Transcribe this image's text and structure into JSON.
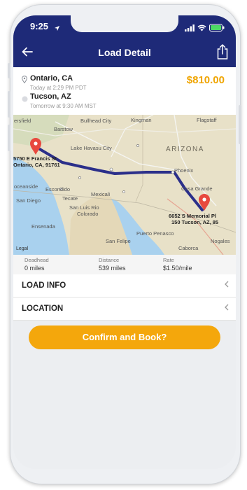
{
  "status_bar": {
    "time": "9:25"
  },
  "header": {
    "title": "Load Detail"
  },
  "route": {
    "origin": {
      "city": "Ontario, CA",
      "time": "Today at 2:29 PM PDT"
    },
    "destination": {
      "city": "Tucson, AZ",
      "time": "Tomorrow at 9:30 AM MST"
    },
    "price": "$810.00"
  },
  "map": {
    "labels": {
      "ersfield": "ersfield",
      "barstow": "Barstow",
      "bullhead": "Bullhead City",
      "kingman": "Kingman",
      "flagstaff": "Flagstaff",
      "lake_havasu": "Lake Havasu City",
      "arizona": "ARIZONA",
      "phoenix": "Phoenix",
      "casa_grande": "Casa Grande",
      "oceanside": "oceanside",
      "escondido": "Escondido",
      "san_diego": "San Diego",
      "tecate": "Tecate",
      "mexicali": "Mexicali",
      "san_luis": "San Luis Rio",
      "colorado": "Colorado",
      "ensenada": "Ensenada",
      "san_felipe": "San Felipe",
      "puerto_penasco": "Puerto Penasco",
      "caborca": "Caborca",
      "nogales": "Nogales",
      "legal": "Legal"
    },
    "origin_address_1": "5750 E Francis St",
    "origin_address_2": "Ontario, CA, 91761",
    "dest_address_1": "6652 S Memorial Pl",
    "dest_address_2": "150 Tucson, AZ, 85"
  },
  "stats": [
    {
      "label": "Deadhead",
      "value": "0 miles"
    },
    {
      "label": "Distance",
      "value": "539 miles"
    },
    {
      "label": "Rate",
      "value": "$1.50/mile"
    }
  ],
  "sections": [
    {
      "label": "LOAD INFO"
    },
    {
      "label": "LOCATION"
    }
  ],
  "actions": {
    "confirm_label": "Confirm and Book?"
  },
  "colors": {
    "header": "#1e2a78",
    "accent": "#f0a500",
    "button": "#f4a70c",
    "route_line": "#2b2f8a",
    "pin": "#e8493f"
  },
  "icons": {
    "back": "arrow-left-icon",
    "share": "share-icon",
    "origin": "location-pin-icon",
    "destination": "destination-dot-icon",
    "chevron": "chevron-left-icon",
    "wifi": "wifi-icon",
    "battery": "battery-icon",
    "signal": "signal-icon",
    "location_arrow": "location-arrow-icon"
  }
}
